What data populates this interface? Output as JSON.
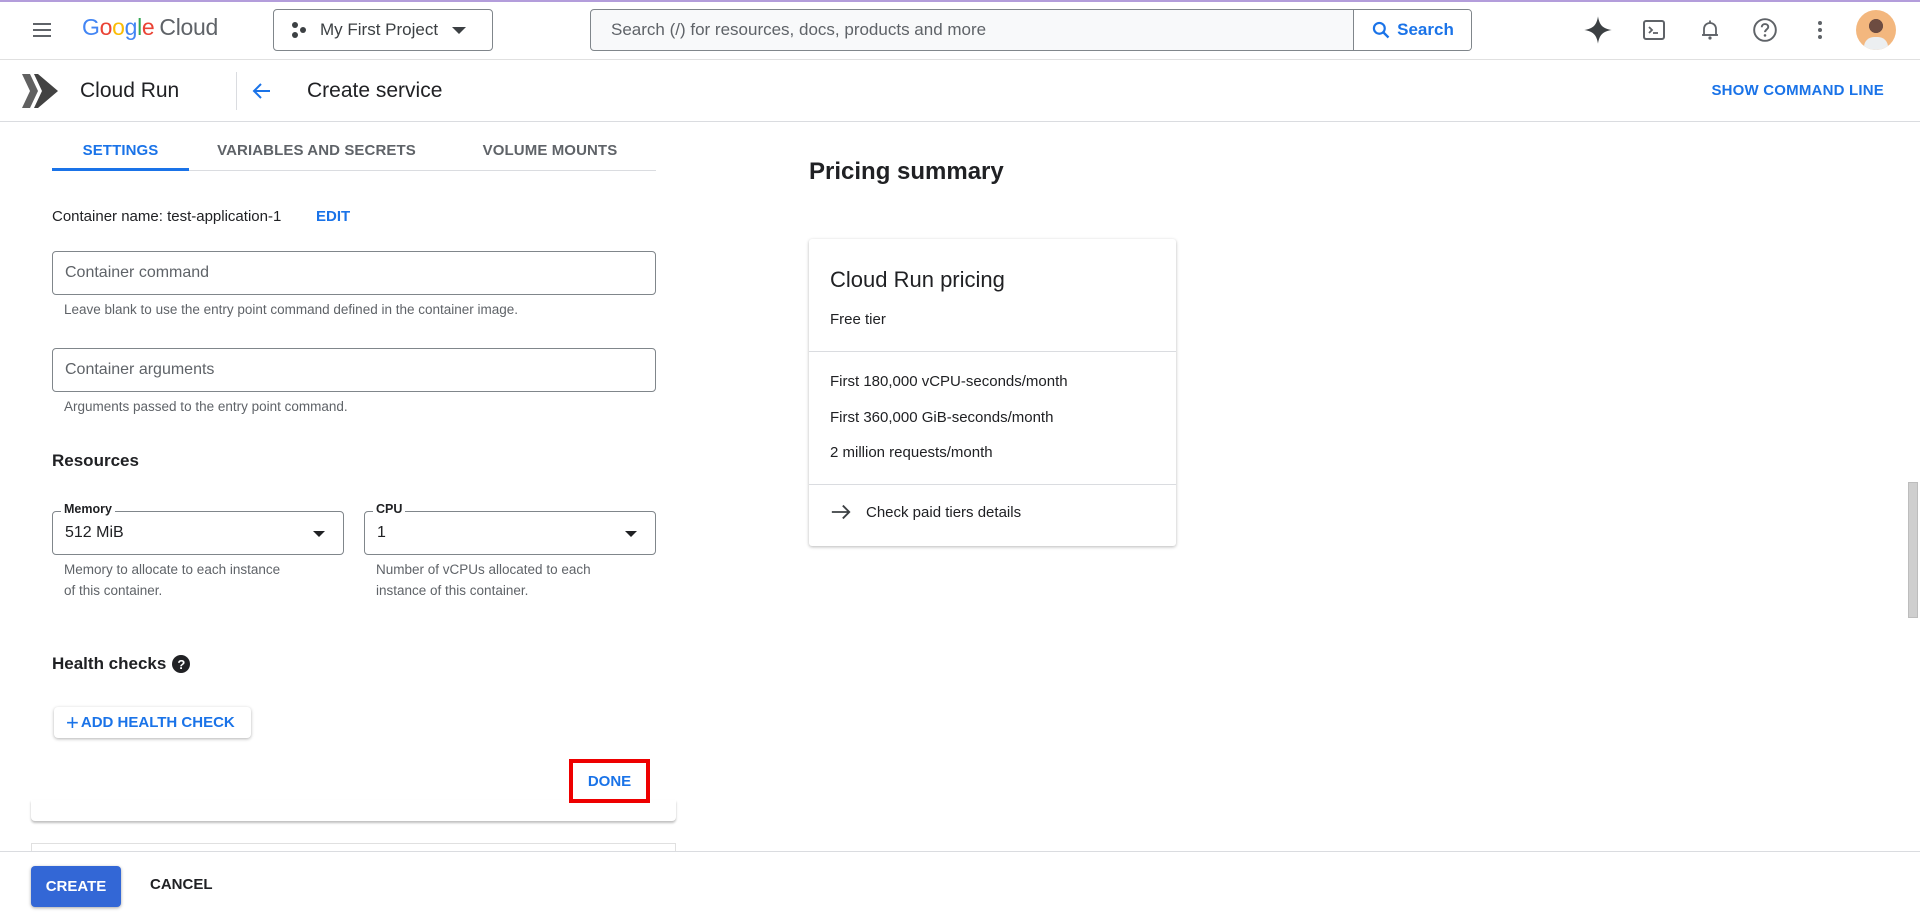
{
  "topbar": {
    "logo_google": [
      "G",
      "o",
      "o",
      "g",
      "l",
      "e"
    ],
    "logo_cloud": "Cloud",
    "project": "My First Project",
    "search_placeholder": "Search (/) for resources, docs, products and more",
    "search_button": "Search",
    "icons": [
      "gemini-sparkle-icon",
      "cloud-shell-icon",
      "notifications-bell-icon",
      "help-icon",
      "more-vert-icon",
      "avatar"
    ]
  },
  "subbar": {
    "product": "Cloud Run",
    "page_title": "Create service",
    "show_command_line": "SHOW COMMAND LINE"
  },
  "tabs": [
    {
      "label": "SETTINGS",
      "active": true
    },
    {
      "label": "VARIABLES AND SECRETS",
      "active": false
    },
    {
      "label": "VOLUME MOUNTS",
      "active": false
    }
  ],
  "container": {
    "name_label": "Container name: test-application-1",
    "edit": "EDIT",
    "command": {
      "placeholder": "Container command",
      "value": "",
      "helper": "Leave blank to use the entry point command defined in the container image."
    },
    "arguments": {
      "placeholder": "Container arguments",
      "value": "",
      "helper": "Arguments passed to the entry point command."
    }
  },
  "resources": {
    "heading": "Resources",
    "memory": {
      "label": "Memory",
      "value": "512 MiB",
      "helper_line1": "Memory to allocate to each instance",
      "helper_line2": "of this container."
    },
    "cpu": {
      "label": "CPU",
      "value": "1",
      "helper_line1": "Number of vCPUs allocated to each",
      "helper_line2": "instance of this container."
    }
  },
  "health": {
    "heading": "Health checks",
    "help_glyph": "?",
    "add_button": "ADD HEALTH CHECK",
    "add_glyph": "+"
  },
  "done_button": "DONE",
  "highlight_color": "#ee0000",
  "pricing": {
    "title": "Pricing summary",
    "card_title": "Cloud Run pricing",
    "subtitle": "Free tier",
    "tiers": [
      "First 180,000 vCPU-seconds/month",
      "First 360,000 GiB-seconds/month",
      "2 million requests/month"
    ],
    "paid_link": "Check paid tiers details"
  },
  "footer": {
    "create": "CREATE",
    "cancel": "CANCEL"
  },
  "colors": {
    "accent": "#1a73e8",
    "primary_button": "#3367d6"
  }
}
